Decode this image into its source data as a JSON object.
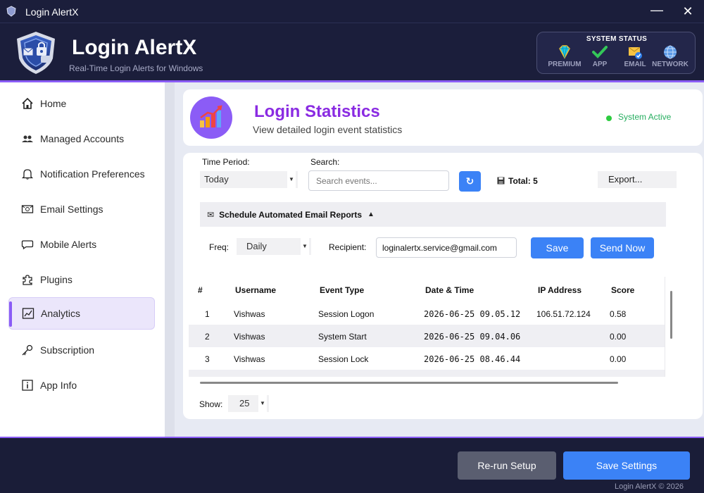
{
  "window": {
    "title": "Login AlertX"
  },
  "header": {
    "brand": "Login AlertX",
    "tagline": "Real-Time Login Alerts for Windows",
    "system_status": {
      "title": "SYSTEM STATUS",
      "items": [
        {
          "label": "PREMIUM",
          "icon": "diamond-icon"
        },
        {
          "label": "APP",
          "icon": "checkmark-icon"
        },
        {
          "label": "EMAIL",
          "icon": "email-check-icon"
        },
        {
          "label": "NETWORK",
          "icon": "globe-icon"
        }
      ]
    }
  },
  "sidebar": {
    "items": [
      {
        "label": "Home",
        "icon": "home-icon"
      },
      {
        "label": "Managed Accounts",
        "icon": "users-icon"
      },
      {
        "label": "Notification Preferences",
        "icon": "bell-icon"
      },
      {
        "label": "Email Settings",
        "icon": "email-icon"
      },
      {
        "label": "Mobile Alerts",
        "icon": "chat-bubble-icon"
      },
      {
        "label": "Plugins",
        "icon": "puzzle-icon"
      },
      {
        "label": "Analytics",
        "icon": "chart-icon",
        "active": true
      },
      {
        "label": "Subscription",
        "icon": "key-icon"
      },
      {
        "label": "App Info",
        "icon": "info-icon"
      }
    ]
  },
  "stats_header": {
    "title": "Login Statistics",
    "subtitle": "View detailed login event statistics",
    "status": "System Active"
  },
  "filters": {
    "time_period_label": "Time Period:",
    "time_period_value": "Today",
    "search_label": "Search:",
    "search_placeholder": "Search events...",
    "refresh_symbol": "↻",
    "total_label": "Total: 5",
    "export_label": "Export..."
  },
  "schedule": {
    "label": "Schedule Automated Email Reports",
    "freq_label": "Freq:",
    "freq_value": "Daily",
    "recipient_label": "Recipient:",
    "recipient_value": "loginalertx.service@gmail.com",
    "save_label": "Save",
    "send_now_label": "Send Now"
  },
  "table": {
    "columns": [
      "#",
      "Username",
      "Event Type",
      "Date & Time",
      "IP Address",
      "Score"
    ],
    "rows": [
      {
        "num": "1",
        "username": "Vishwas",
        "event": "Session Logon",
        "datetime": "2026-06-25 09.05.12",
        "ip": "106.51.72.124",
        "score": "0.58"
      },
      {
        "num": "2",
        "username": "Vishwas",
        "event": "System Start",
        "datetime": "2026-06-25 09.04.06",
        "ip": "",
        "score": "0.00"
      },
      {
        "num": "3",
        "username": "Vishwas",
        "event": "Session Lock",
        "datetime": "2026-06-25 08.46.44",
        "ip": "",
        "score": "0.00"
      }
    ]
  },
  "pagination": {
    "show_label": "Show:",
    "show_value": "25"
  },
  "footer": {
    "rerun_label": "Re-run Setup",
    "save_label": "Save Settings",
    "copyright": "Login AlertX © 2026"
  },
  "colors": {
    "accent": "#8a5cf6",
    "primary_button": "#3b82f6",
    "header_bg": "#1b1e3b",
    "title_purple": "#8a2be2",
    "active_green": "#2ecc40"
  }
}
